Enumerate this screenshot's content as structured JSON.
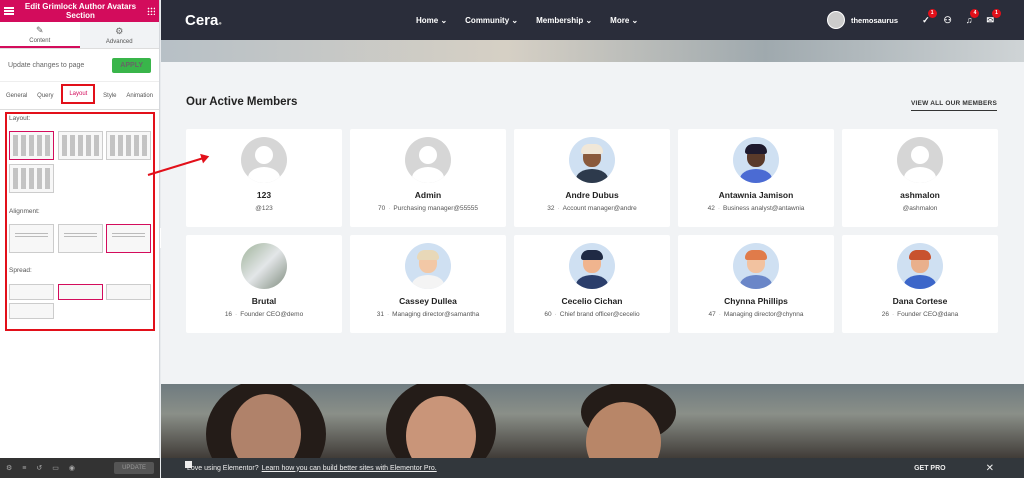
{
  "editor": {
    "header_title": "Edit Grimlock Author Avatars Section",
    "tabs": [
      {
        "label": "Content",
        "icon": "pencil-icon"
      },
      {
        "label": "Advanced",
        "icon": "gear-icon"
      }
    ],
    "update_text": "Update changes to page",
    "apply_label": "APPLY",
    "subtabs": [
      "General",
      "Query",
      "Layout",
      "Style",
      "Animation"
    ],
    "sections": {
      "layout": "Layout:",
      "alignment": "Alignment:",
      "spread": "Spread:"
    },
    "footer_update": "UPDATE",
    "accent": "#d30c5c"
  },
  "site": {
    "logo": "Cera",
    "nav": [
      "Home",
      "Community",
      "Membership",
      "More"
    ],
    "username": "themosaurus",
    "badges": {
      "tasks": "1",
      "notifications": "4",
      "messages": "1"
    }
  },
  "members_section": {
    "title": "Our Active Members",
    "view_all": "VIEW ALL OUR MEMBERS",
    "members": [
      {
        "name": "123",
        "number": "",
        "role": "@123",
        "avatar": "default-avatar"
      },
      {
        "name": "Admin",
        "number": "70",
        "role": "Purchasing manager@55555",
        "avatar": "default-avatar"
      },
      {
        "name": "Andre Dubus",
        "number": "32",
        "role": "Account manager@andre",
        "avatar": "illustrated-avatar"
      },
      {
        "name": "Antawnia Jamison",
        "number": "42",
        "role": "Business analyst@antawnia",
        "avatar": "illustrated-avatar"
      },
      {
        "name": "ashmalon",
        "number": "",
        "role": "@ashmalon",
        "avatar": "default-avatar"
      },
      {
        "name": "Brutal",
        "number": "16",
        "role": "Founder CEO@demo",
        "avatar": "photo-avatar"
      },
      {
        "name": "Cassey Dullea",
        "number": "31",
        "role": "Managing director@samantha",
        "avatar": "illustrated-avatar"
      },
      {
        "name": "Cecelio Cichan",
        "number": "60",
        "role": "Chief brand officer@cecelio",
        "avatar": "illustrated-avatar"
      },
      {
        "name": "Chynna Phillips",
        "number": "47",
        "role": "Managing director@chynna",
        "avatar": "illustrated-avatar"
      },
      {
        "name": "Dana Cortese",
        "number": "26",
        "role": "Founder CEO@dana",
        "avatar": "illustrated-avatar"
      }
    ]
  },
  "promo": {
    "text": "Love using Elementor?",
    "link": "Learn how you can build better sites with Elementor Pro.",
    "cta": "GET PRO"
  }
}
